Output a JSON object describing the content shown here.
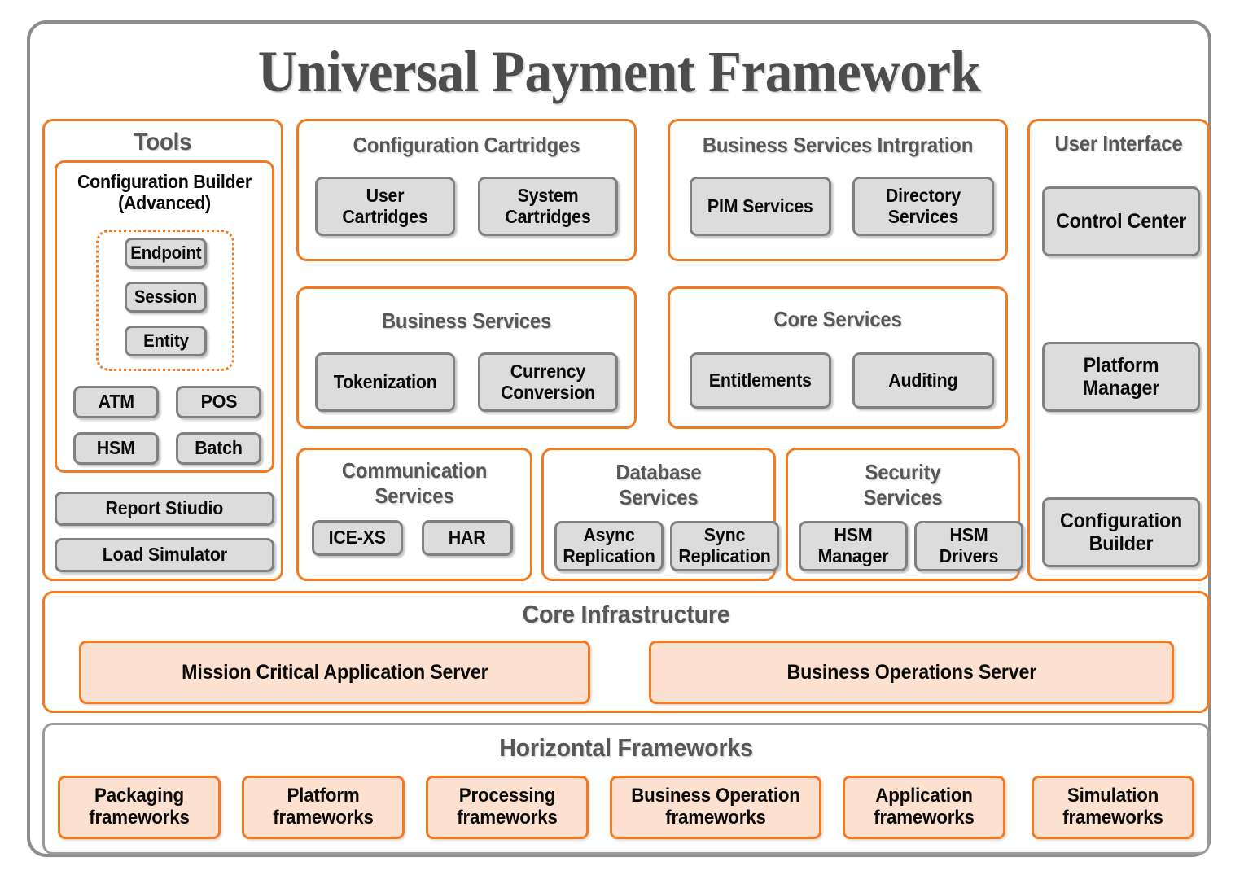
{
  "title": "Universal Payment Framework",
  "colors": {
    "accent_orange": "#F4791F",
    "frame_gray": "#8C8C8C",
    "node_gray_fill": "#DCDCDC",
    "node_gray_border": "#808080",
    "peach_fill": "#FDE1D0",
    "title_gray": "#4D4D4D"
  },
  "tools": {
    "title": "Tools",
    "config_builder": {
      "title_line1": "Configuration Builder",
      "title_line2": "(Advanced)",
      "dotted_items": [
        "Endpoint",
        "Session",
        "Entity"
      ],
      "grid_items": [
        "ATM",
        "POS",
        "HSM",
        "Batch"
      ]
    },
    "extra_items": [
      "Report Stiudio",
      "Load Simulator"
    ]
  },
  "configuration_cartridges": {
    "title": "Configuration Cartridges",
    "items": [
      "User Cartridges",
      "System Cartridges"
    ]
  },
  "business_services": {
    "title": "Business Services",
    "items": [
      "Tokenization",
      "Currency Conversion"
    ]
  },
  "business_services_integration": {
    "title": "Business Services Intrgration",
    "items": [
      "PIM Services",
      "Directory Services"
    ]
  },
  "core_services": {
    "title": "Core Services",
    "items": [
      "Entitlements",
      "Auditing"
    ]
  },
  "communication_services": {
    "title_line1": "Communication",
    "title_line2": "Services",
    "items": [
      "ICE-XS",
      "HAR"
    ]
  },
  "database_services": {
    "title_line1": "Database",
    "title_line2": "Services",
    "items": [
      "Async Replication",
      "Sync Replication"
    ]
  },
  "security_services": {
    "title_line1": "Security",
    "title_line2": "Services",
    "items": [
      "HSM Manager",
      "HSM Drivers"
    ]
  },
  "user_interface": {
    "title": "User Interface",
    "items": [
      "Control Center",
      "Platform Manager",
      "Configuration Builder"
    ]
  },
  "core_infrastructure": {
    "title": "Core Infrastructure",
    "items": [
      "Mission Critical Application Server",
      "Business Operations Server"
    ]
  },
  "horizontal_frameworks": {
    "title": "Horizontal Frameworks",
    "items": [
      "Packaging frameworks",
      "Platform frameworks",
      "Processing frameworks",
      "Business Operation frameworks",
      "Application frameworks",
      "Simulation frameworks"
    ]
  }
}
